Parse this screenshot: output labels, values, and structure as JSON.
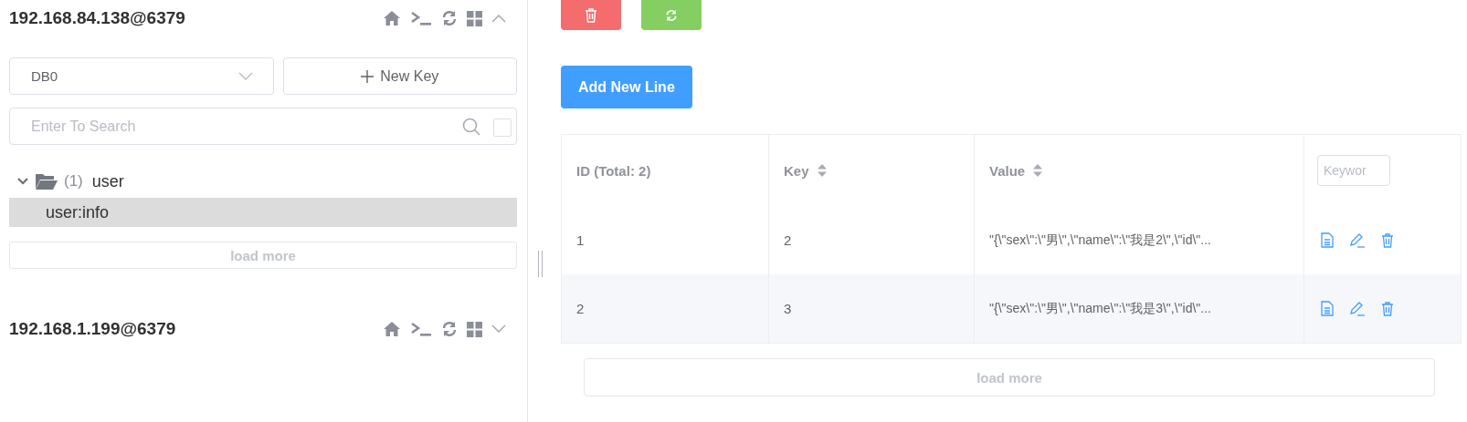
{
  "connections": [
    {
      "host": "192.168.84.138@6379",
      "expanded": true,
      "db": "DB0",
      "new_key": "New Key",
      "search": {
        "placeholder": "Enter To Search",
        "checked": false
      },
      "tree": [
        {
          "count": "(1)",
          "name": "user",
          "expanded": true,
          "children": [
            {
              "name": "user:info",
              "selected": true
            }
          ]
        }
      ],
      "load_more": "load more"
    },
    {
      "host": "192.168.1.199@6379",
      "expanded": false
    }
  ],
  "detail": {
    "add_button": "Add New Line",
    "table": {
      "columns": [
        {
          "label": "ID (Total: 2)",
          "sortable": false
        },
        {
          "label": "Key",
          "sortable": true
        },
        {
          "label": "Value",
          "sortable": true
        }
      ],
      "filter_placeholder": "Keywor",
      "rows": [
        {
          "id": "1",
          "key": "2",
          "value": "\"{\\\"sex\\\":\\\"男\\\",\\\"name\\\":\\\"我是2\\\",\\\"id\\\"..."
        },
        {
          "id": "2",
          "key": "3",
          "value": "\"{\\\"sex\\\":\\\"男\\\",\\\"name\\\":\\\"我是3\\\",\\\"id\\\"..."
        }
      ]
    },
    "load_more": "load more"
  }
}
